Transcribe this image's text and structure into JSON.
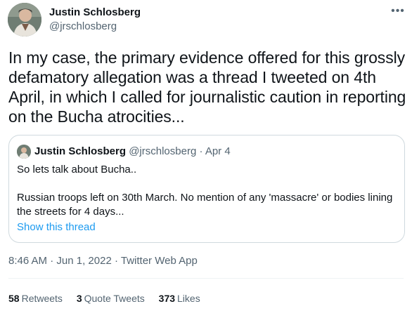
{
  "author": {
    "name": "Justin Schlosberg",
    "handle": "@jrschlosberg"
  },
  "tweet": {
    "text": "In my case, the primary evidence offered for this grossly defamatory allegation was a thread I tweeted on 4th April, in which I called for journalistic caution in reporting on the Bucha atrocities...",
    "time": "8:46 AM",
    "date": "Jun 1, 2022",
    "source": "Twitter Web App"
  },
  "quote": {
    "name": "Justin Schlosberg",
    "handle": "@jrschlosberg",
    "date": "Apr 4",
    "line1": "So lets talk about Bucha..",
    "line2": "Russian troops left on 30th March. No mention of any 'massacre' or bodies lining the streets for 4 days...",
    "show_thread": "Show this thread"
  },
  "stats": {
    "retweets_count": "58",
    "retweets_label": "Retweets",
    "quotes_count": "3",
    "quotes_label": "Quote Tweets",
    "likes_count": "373",
    "likes_label": "Likes"
  },
  "icons": {
    "more": "more-horizontal-icon"
  },
  "colors": {
    "link": "#1d9bf0",
    "secondary_text": "#536471",
    "border": "#cfd9de"
  },
  "separators": {
    "dot": "·"
  }
}
